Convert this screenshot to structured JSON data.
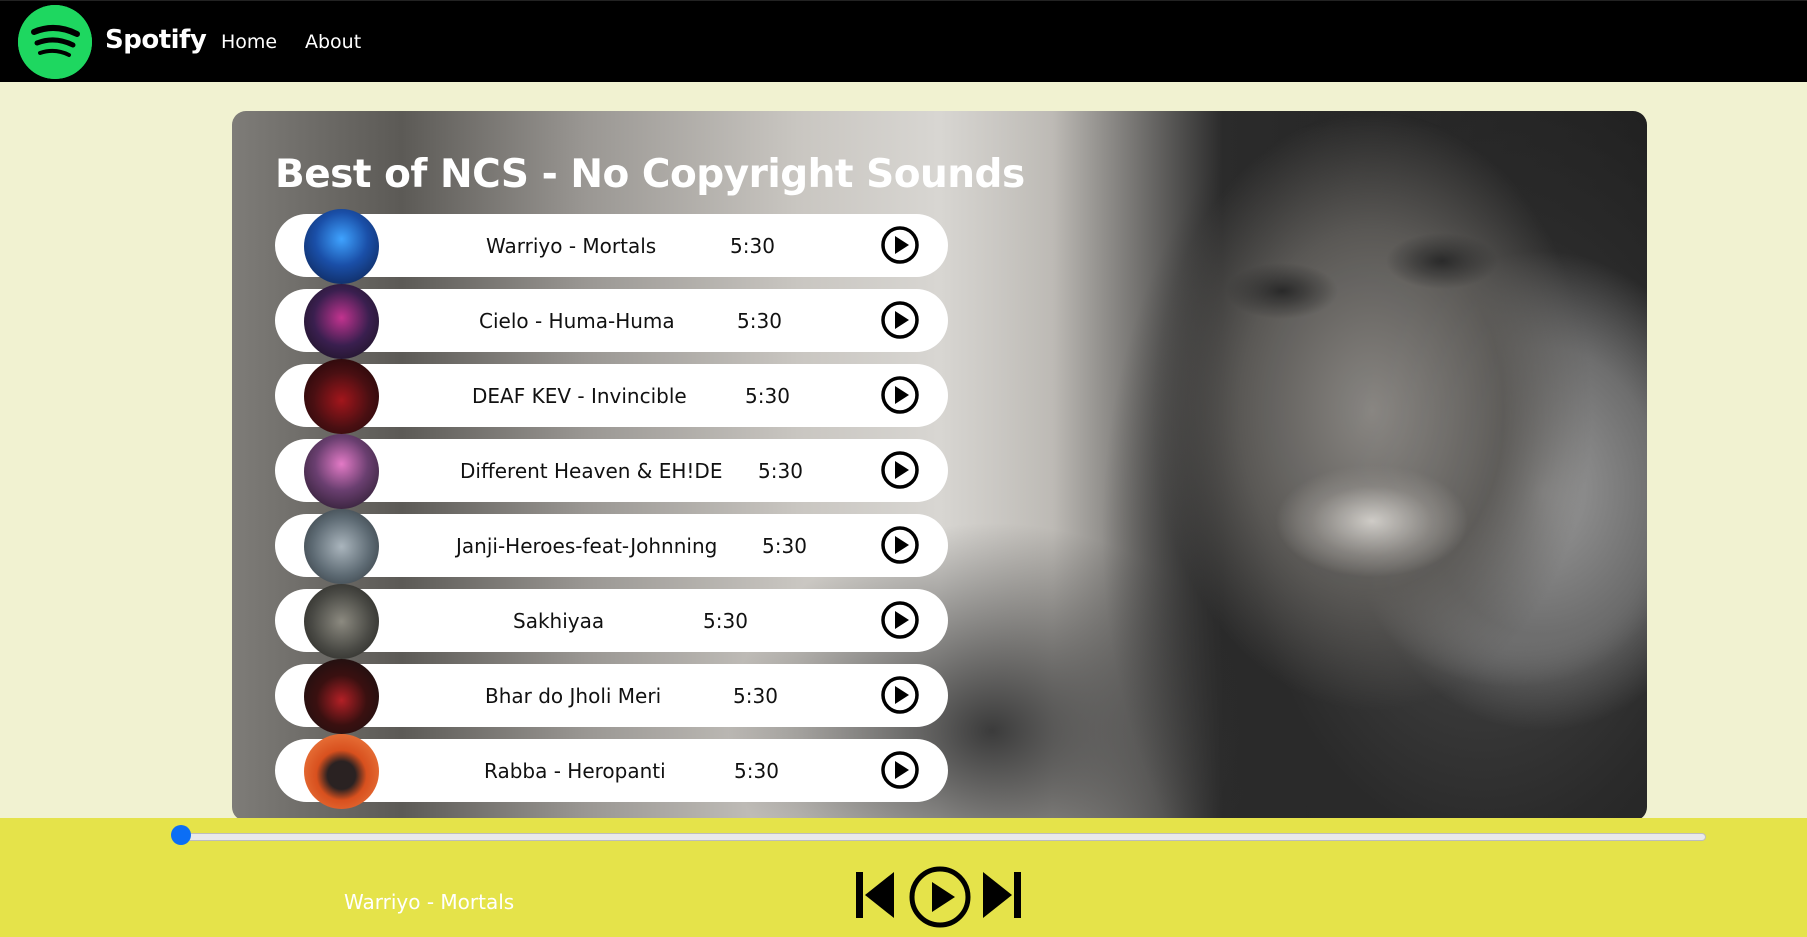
{
  "nav": {
    "brand": "Spotify",
    "links": [
      "Home",
      "About"
    ]
  },
  "playlist": {
    "title": "Best of NCS - No Copyright Sounds",
    "songs": [
      {
        "name": "Warriyo - Mortals",
        "duration": "5:30",
        "cover_color": "#1a4fa8"
      },
      {
        "name": "Cielo - Huma-Huma",
        "duration": "5:30",
        "cover_color": "#2b1a3d"
      },
      {
        "name": "DEAF KEV - Invincible",
        "duration": "5:30",
        "cover_color": "#4a0f12"
      },
      {
        "name": "Different Heaven & EH!DE",
        "duration": "5:30",
        "cover_color": "#3a2b3f"
      },
      {
        "name": "Janji-Heroes-feat-Johnning",
        "duration": "5:30",
        "cover_color": "#5d6a73"
      },
      {
        "name": "Sakhiyaa",
        "duration": "5:30",
        "cover_color": "#4a4a45"
      },
      {
        "name": "Bhar do Jholi Meri",
        "duration": "5:30",
        "cover_color": "#1b1b1b"
      },
      {
        "name": "Rabba - Heropanti",
        "duration": "5:30",
        "cover_color": "#d8501e"
      }
    ]
  },
  "player": {
    "now_playing": "Warriyo - Mortals",
    "progress": 0
  },
  "colors": {
    "brand_green": "#1ed760",
    "bottom_bar": "#e5e34a",
    "page_bg": "#f1f2d1",
    "progress_thumb": "#0b6ef5"
  },
  "icons": {
    "logo": "spotify-logo-icon",
    "play": "play-circle-icon",
    "prev": "skip-back-icon",
    "next": "skip-forward-icon"
  }
}
